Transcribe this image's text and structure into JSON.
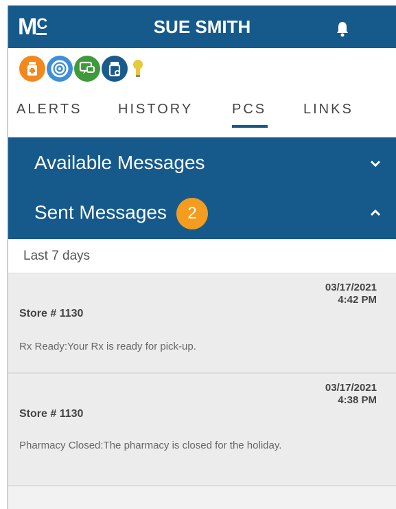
{
  "header": {
    "logo": "Mc",
    "user_name": "SUE SMITH",
    "bell_icon": "bell-icon"
  },
  "icons": [
    {
      "name": "pill-bottle-icon",
      "color": "#f2891e"
    },
    {
      "name": "target-icon",
      "color": "#3d8fd6"
    },
    {
      "name": "chat-icon",
      "color": "#3f9a3a"
    },
    {
      "name": "prescription-icon",
      "color": "#1a5a8c"
    },
    {
      "name": "lightbulb-icon",
      "color": "#e8c93a"
    }
  ],
  "tabs": [
    {
      "label": "ALERTS"
    },
    {
      "label": "HISTORY"
    },
    {
      "label": "PCS"
    },
    {
      "label": "LINKS"
    }
  ],
  "active_tab": "PCS",
  "sections": {
    "available": {
      "label": "Available Messages",
      "chevron": "⌄"
    },
    "sent": {
      "label": "Sent Messages",
      "badge": "2",
      "chevron": "⌃"
    }
  },
  "filter_label": "Last 7 days",
  "messages": [
    {
      "date": "03/17/2021",
      "time": "4:42 PM",
      "store": "Store # 1130",
      "text": "Rx Ready:Your Rx is ready for pick-up."
    },
    {
      "date": "03/17/2021",
      "time": "4:38 PM",
      "store": "Store # 1130",
      "text": "Pharmacy Closed:The pharmacy is closed for the holiday."
    }
  ],
  "colors": {
    "brand_blue": "#165a8c",
    "badge_orange": "#f39c1f"
  }
}
